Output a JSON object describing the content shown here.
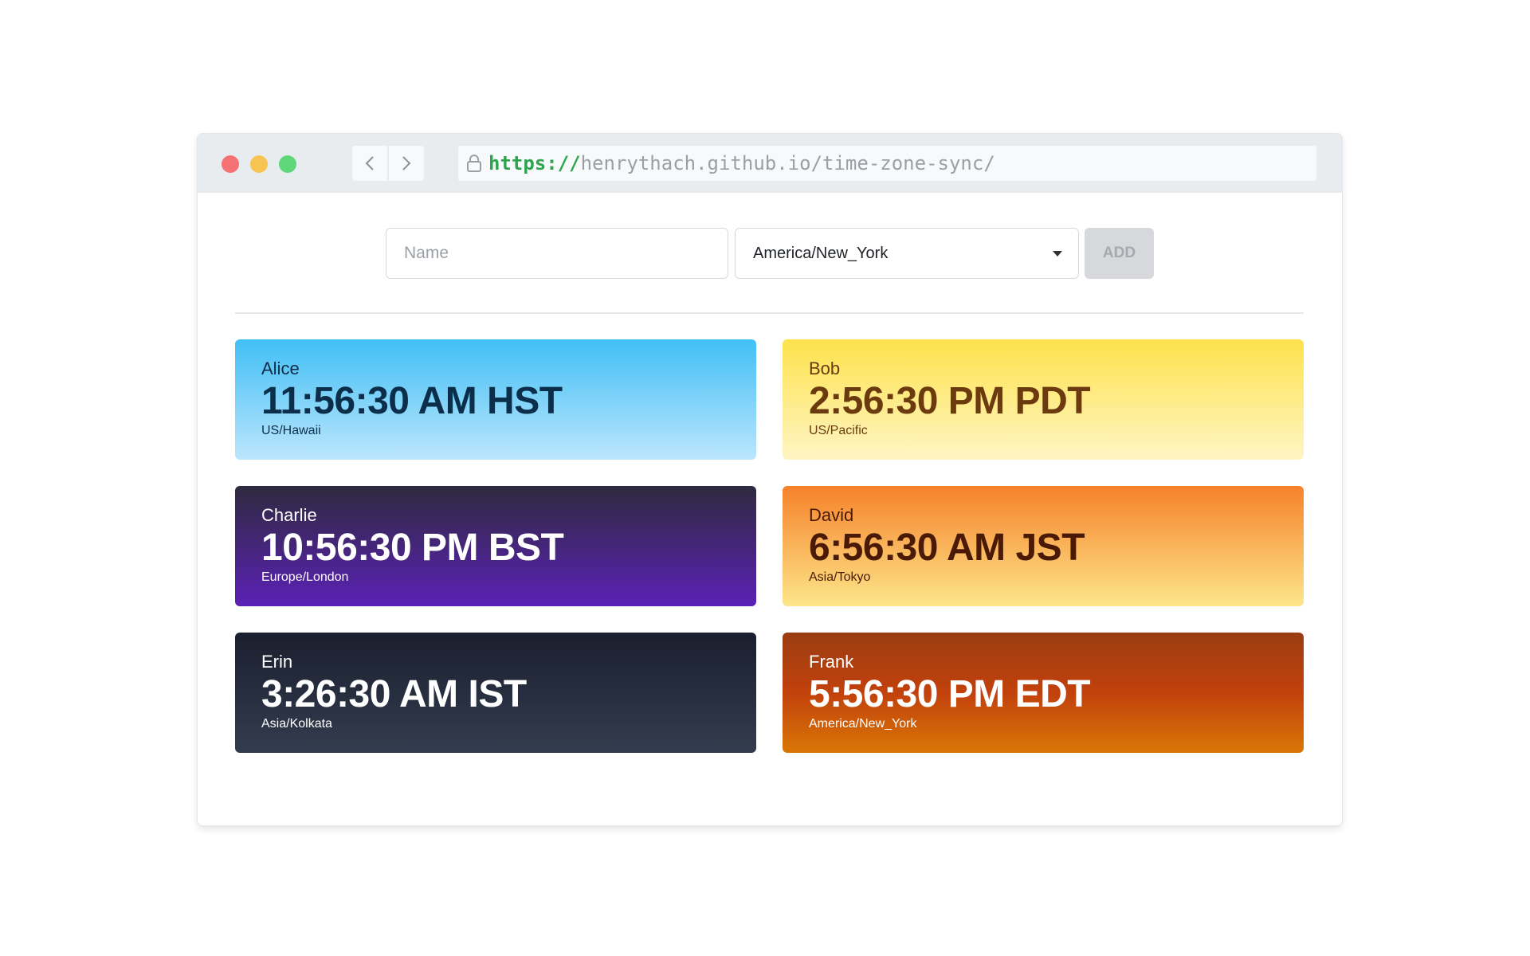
{
  "browser": {
    "url_scheme": "https://",
    "url_rest": "henrythach.github.io/time-zone-sync/"
  },
  "form": {
    "name_placeholder": "Name",
    "timezone_selected": "America/New_York",
    "add_label": "ADD"
  },
  "cards": [
    {
      "name": "Alice",
      "time": "11:56:30 AM HST",
      "zone": "US/Hawaii"
    },
    {
      "name": "Bob",
      "time": "2:56:30 PM PDT",
      "zone": "US/Pacific"
    },
    {
      "name": "Charlie",
      "time": "10:56:30 PM BST",
      "zone": "Europe/London"
    },
    {
      "name": "David",
      "time": "6:56:30 AM JST",
      "zone": "Asia/Tokyo"
    },
    {
      "name": "Erin",
      "time": "3:26:30 AM IST",
      "zone": "Asia/Kolkata"
    },
    {
      "name": "Frank",
      "time": "5:56:30 PM EDT",
      "zone": "America/New_York"
    }
  ],
  "colors": {
    "url_scheme": "#2da44e",
    "traffic_red": "#f47174",
    "traffic_yellow": "#f8c451",
    "traffic_green": "#5fd67a"
  }
}
